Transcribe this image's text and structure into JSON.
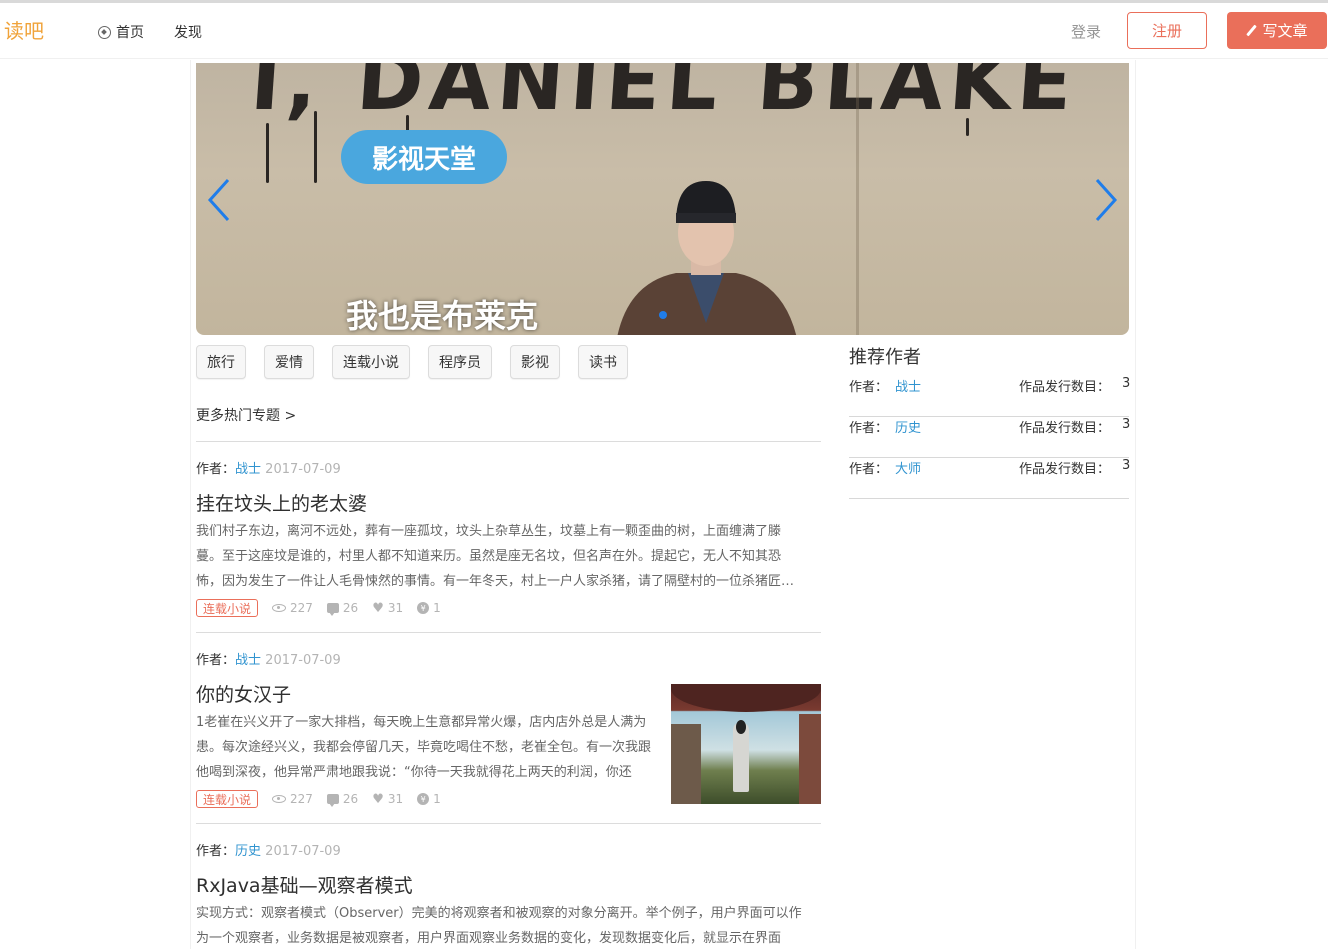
{
  "nav": {
    "logo": "读吧",
    "home": "首页",
    "discover": "发现",
    "login": "登录",
    "register": "注册",
    "write": "写文章"
  },
  "banner": {
    "graffiti": "I, DANIEL BLAKE",
    "badge": "影视天堂",
    "caption": "我也是布莱克"
  },
  "tags": [
    "旅行",
    "爱情",
    "连载小说",
    "程序员",
    "影视",
    "读书"
  ],
  "more_topics": "更多热门专题 >",
  "articles": [
    {
      "author_label": "作者：",
      "author": "战士",
      "date": "2017-07-09",
      "title": "挂在坟头上的老太婆",
      "abstract": "我们村子东边，离河不远处，葬有一座孤坟，坟头上杂草丛生，坟墓上有一颗歪曲的树，上面缠满了滕蔓。至于这座坟是谁的，村里人都不知道来历。虽然是座无名坟，但名声在外。提起它，无人不知其恐怖，因为发生了一件让人毛骨悚然的事情。有一年冬天，村上一户人家杀猪，请了隔壁村的一位杀猪匠…",
      "series": "连载小说",
      "views": "227",
      "comments": "26",
      "likes": "31",
      "rewards": "1"
    },
    {
      "author_label": "作者：",
      "author": "战士",
      "date": "2017-07-09",
      "title": "你的女汉子",
      "abstract": "1老崔在兴义开了一家大排档，每天晚上生意都异常火爆，店内店外总是人满为患。每次途经兴义，我都会停留几天，毕竟吃喝住不愁，老崔全包。有一次我跟他喝到深夜，他异常严肃地跟我说：“你待一天我就得花上两天的利润，你还是…",
      "series": "连载小说",
      "views": "227",
      "comments": "26",
      "likes": "31",
      "rewards": "1"
    },
    {
      "author_label": "作者：",
      "author": "历史",
      "date": "2017-07-09",
      "title": "RxJava基础—观察者模式",
      "abstract": "实现方式：观察者模式（Observer）完美的将观察者和被观察的对象分离开。举个例子，用户界面可以作为一个观察者，业务数据是被观察者，用户界面观察业务数据的变化，发现数据变化后，就显示在界面"
    }
  ],
  "recommend": {
    "title": "推荐作者",
    "items": [
      {
        "label": "作者：",
        "name": "战士",
        "count_label": "作品发行数目：",
        "count": "3"
      },
      {
        "label": "作者：",
        "name": "历史",
        "count_label": "作品发行数目：",
        "count": "3"
      },
      {
        "label": "作者：",
        "name": "大师",
        "count_label": "作品发行数目：",
        "count": "3"
      }
    ]
  },
  "colors": {
    "accent": "#ea6f5a",
    "link": "#3194d0",
    "badge": "#4aa7de"
  }
}
